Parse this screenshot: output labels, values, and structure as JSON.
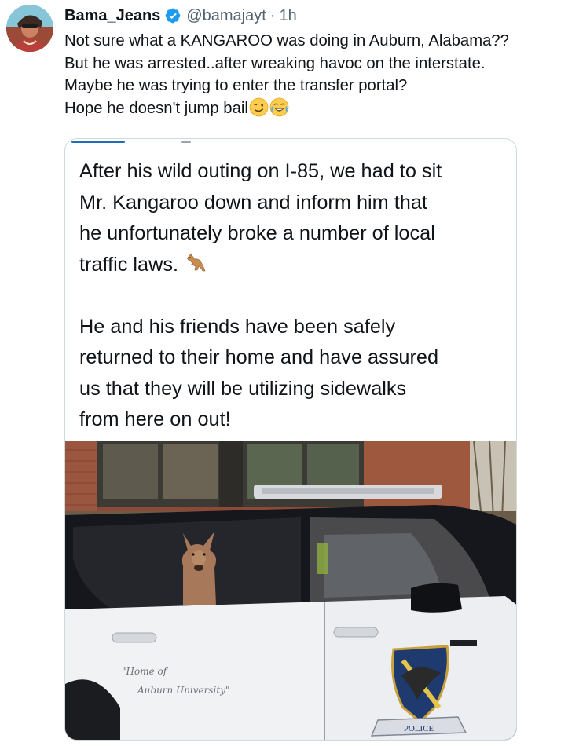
{
  "post": {
    "author": {
      "display_name": "Bama_Jeans",
      "handle": "@bamajayt",
      "separator": "·",
      "timestamp": "1h",
      "verified": true,
      "avatar_icon": "profile-photo"
    },
    "text_lines": [
      "Not sure what a KANGAROO was doing in Auburn, Alabama??",
      "But he was arrested..after wreaking  havoc on the interstate.",
      "Maybe he was trying to enter the transfer portal?",
      "Hope he doesn't jump bail"
    ],
    "emojis": [
      "winking-face-emoji",
      "face-with-tears-of-joy-emoji"
    ]
  },
  "quote": {
    "paragraph1": [
      "After his wild outing on I-85, we had to sit",
      "Mr. Kangaroo down and inform him that",
      "he unfortunately broke a number of local",
      "traffic laws."
    ],
    "paragraph1_emoji": "kangaroo-emoji",
    "paragraph2": [
      "He and his friends have been safely",
      "returned to their home and have assured",
      "us that they will be utilizing sidewalks",
      "from here on out!"
    ],
    "image": {
      "door_script_line1": "\"Home of",
      "door_script_line2": "Auburn University\"",
      "badge_text": "POLICE"
    }
  },
  "colors": {
    "text_primary": "#0f1419",
    "text_secondary": "#536471",
    "verified_blue": "#1d9bf0",
    "card_border": "#cfd9de"
  }
}
